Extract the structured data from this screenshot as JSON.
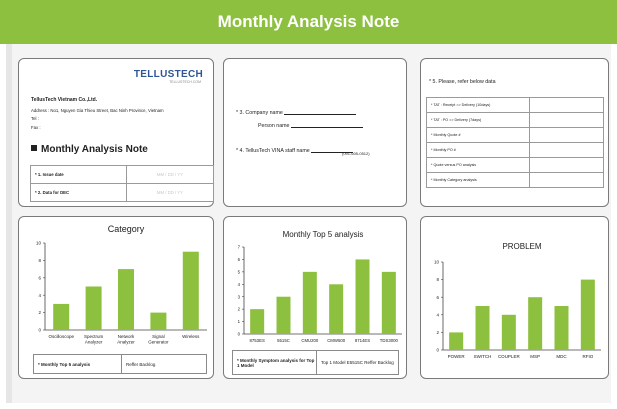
{
  "banner": {
    "title": "Monthly Analysis Note"
  },
  "card1": {
    "logo": "TELLUSTECH",
    "logo_sub": "TELLUSTECH.COM",
    "company": "TellusTech Vietnam Co.,Ltd.",
    "address": "Address : No1, Nguyen Gia Thieu Street, Bac Ninh Province, Vietnam",
    "tel": "Tel :",
    "fax": "Fax :",
    "title": "Monthly Analysis Note",
    "rows": [
      {
        "label": "* 1. Issue date",
        "value": "MM / DD / YY"
      },
      {
        "label": "* 2. Data for DEC",
        "value": "MM / DD / YY"
      }
    ]
  },
  "card2": {
    "company_label": "* 3. Company name",
    "person_label": "Person name",
    "staff_label": "* 4. TellusTech VINA staff name",
    "phone": "(091-605-0512)"
  },
  "card3": {
    "heading": "* 5. Please, refer below data",
    "rows": [
      "* TAT : Receipt => Delivery (10days)",
      "* TAT : PO => Delivery (7days)",
      "* Monthly Quote #",
      "* Monthly PO #",
      "* Quote versus PO analysis",
      "* Monthly Category analysis"
    ]
  },
  "colors": {
    "accent": "#8dc03f",
    "bar": "#8dc03f"
  },
  "chart_data": [
    {
      "type": "bar",
      "title": "Category",
      "categories": [
        "Oscilloscope",
        "Spectrum Analyzer",
        "Network Analyzer",
        "Signal Generator",
        "Wireless"
      ],
      "values": [
        3,
        5,
        7,
        2,
        9
      ],
      "ylim": [
        0,
        10
      ],
      "yticks": [
        0,
        2,
        4,
        6,
        8,
        10
      ],
      "grid": false
    },
    {
      "type": "bar",
      "title": "Monthly Top 5 analysis",
      "categories": [
        "8753ES",
        "5515C",
        "CMU200",
        "CMW500",
        "8714ES",
        "TDS3000"
      ],
      "values": [
        2,
        3,
        5,
        4,
        6,
        5
      ],
      "ylim": [
        0,
        7
      ],
      "yticks": [
        0,
        1,
        2,
        3,
        4,
        5,
        6,
        7
      ],
      "grid": false
    },
    {
      "type": "bar",
      "title": "PROBLEM",
      "categories": [
        "POWER",
        "SWITCH",
        "COUPLER",
        "MSP",
        "MDC",
        "RFIO"
      ],
      "values": [
        2,
        5,
        4,
        6,
        5,
        8
      ],
      "ylim": [
        0,
        10
      ],
      "yticks": [
        0,
        2,
        4,
        6,
        8,
        10
      ],
      "grid": false
    }
  ],
  "chart1_table": {
    "label": "* Monthly Top 5 analysis",
    "value": "Reffer Backlog"
  },
  "chart2_table": {
    "label": "* Monthly Symptom analysis for Top 1 Model",
    "value": "Top 1 Model E5515C Reffer Backlog"
  }
}
